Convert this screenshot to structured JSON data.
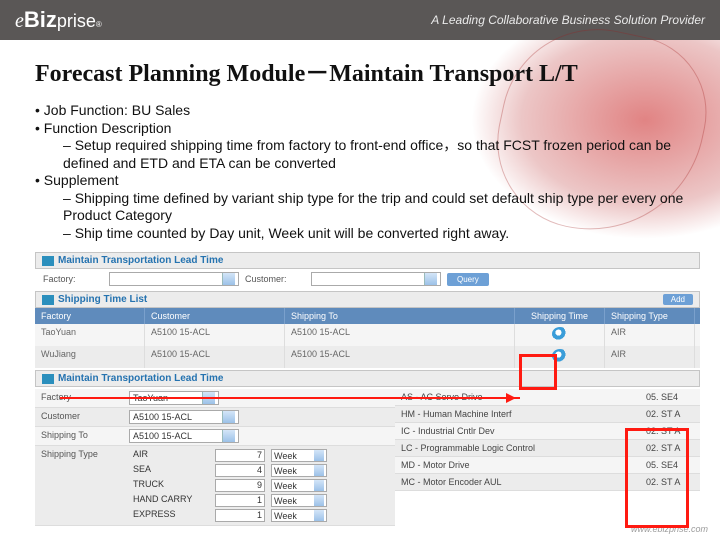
{
  "brand": {
    "e": "e",
    "bold": "Biz",
    "rest": "prise",
    "reg": "®"
  },
  "tagline": "A Leading Collaborative Business Solution Provider",
  "title": "Forecast Planning Module－Maintain Transport L/T",
  "bullets": {
    "b1": "Job Function: BU Sales",
    "b2": "Function Description",
    "b2a": "Setup required shipping time from factory to front-end office，so that FCST frozen period can be defined and ETD and ETA can be converted",
    "b3": "Supplement",
    "b3a": "Shipping time defined by variant ship type for the trip and could set default ship type per every one Product Category",
    "b3b": "Ship time counted by Day unit, Week unit will be converted right away."
  },
  "app": {
    "panel1": "Maintain Transportation Lead Time",
    "panel2": "Shipping Time List",
    "panel3": "Maintain Transportation Lead Time",
    "factory": "Factory:",
    "customer": "Customer:",
    "query": "Query",
    "add": "Add",
    "cols": {
      "factory": "Factory",
      "customer": "Customer",
      "shippingto": "Shipping To",
      "shiptime": "Shipping Time",
      "shiptype": "Shipping Type"
    },
    "rows": [
      {
        "f": "TaoYuan",
        "c": "A5100 15-ACL",
        "s": "A5100 15-ACL",
        "ty": "AIR"
      },
      {
        "f": "WuJiang",
        "c": "A5100 15-ACL",
        "s": "A5100 15-ACL",
        "ty": "AIR"
      }
    ],
    "form": {
      "factory": "Factory",
      "factory_val": "TaoYuan",
      "customer": "Customer",
      "customer_val": "A5100 15-ACL",
      "shippingto": "Shipping To",
      "shippingto_val": "A5100 15-ACL",
      "shippingtype": "Shipping Type",
      "types": [
        {
          "name": "AIR",
          "qty": "7",
          "unit": "Week"
        },
        {
          "name": "SEA",
          "qty": "4",
          "unit": "Week"
        },
        {
          "name": "TRUCK",
          "qty": "9",
          "unit": "Week"
        },
        {
          "name": "HAND CARRY",
          "qty": "1",
          "unit": "Week"
        },
        {
          "name": "EXPRESS",
          "qty": "1",
          "unit": "Week"
        }
      ]
    },
    "cats": [
      {
        "desc": "AS - AC Servo Drive",
        "code": "05. SE4"
      },
      {
        "desc": "HM - Human Machine Interf",
        "code": "02. ST A"
      },
      {
        "desc": "IC - Industrial Cntlr Dev",
        "code": "02. ST A"
      },
      {
        "desc": "LC - Programmable Logic Control",
        "code": "02. ST A"
      },
      {
        "desc": "MD - Motor Drive",
        "code": "05. SE4"
      },
      {
        "desc": "MC - Motor Encoder AUL",
        "code": "02. ST A"
      }
    ]
  },
  "footer_url": "www.ebizprise.com"
}
